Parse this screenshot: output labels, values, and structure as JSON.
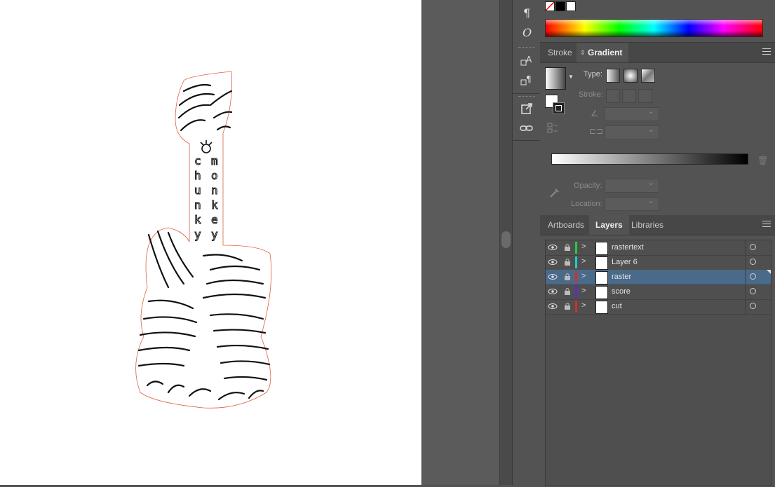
{
  "canvas": {
    "artwork_text": [
      "c",
      "h",
      "u",
      "n",
      "k",
      "y",
      "m",
      "o",
      "n",
      "k",
      "e",
      "y"
    ]
  },
  "color_panel": {
    "swatches": [
      "none",
      "black",
      "white"
    ]
  },
  "tabs_top": [
    {
      "label": "Stroke",
      "active": false
    },
    {
      "label": "Gradient",
      "active": true
    }
  ],
  "gradient": {
    "type_label": "Type:",
    "stroke_label": "Stroke:",
    "opacity_label": "Opacity:",
    "location_label": "Location:"
  },
  "tabs_bottom": [
    {
      "label": "Artboards",
      "active": false
    },
    {
      "label": "Layers",
      "active": true
    },
    {
      "label": "Libraries",
      "active": false
    }
  ],
  "layers": [
    {
      "name": "rastertext",
      "color": "#22cc44",
      "selected": false
    },
    {
      "name": "Layer 6",
      "color": "#22cccc",
      "selected": false
    },
    {
      "name": "raster",
      "color": "#dd2a2a",
      "selected": true
    },
    {
      "name": "score",
      "color": "#5a2ad6",
      "selected": false
    },
    {
      "name": "cut",
      "color": "#dd2a2a",
      "selected": false
    }
  ]
}
